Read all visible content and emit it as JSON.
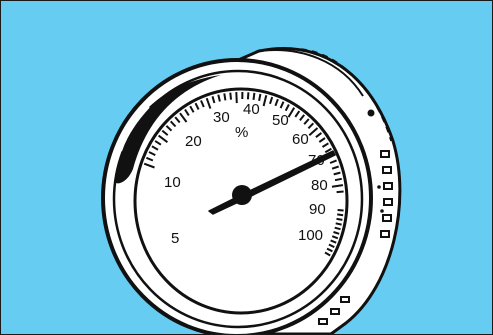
{
  "colors": {
    "background": "#66ccf2",
    "ink": "#111111",
    "face": "#ffffff"
  },
  "gauge": {
    "unit_symbol": "%",
    "scale_labels": [
      "5",
      "10",
      "20",
      "30",
      "40",
      "50",
      "60",
      "70",
      "80",
      "90",
      "100"
    ],
    "needle_value": 70
  }
}
